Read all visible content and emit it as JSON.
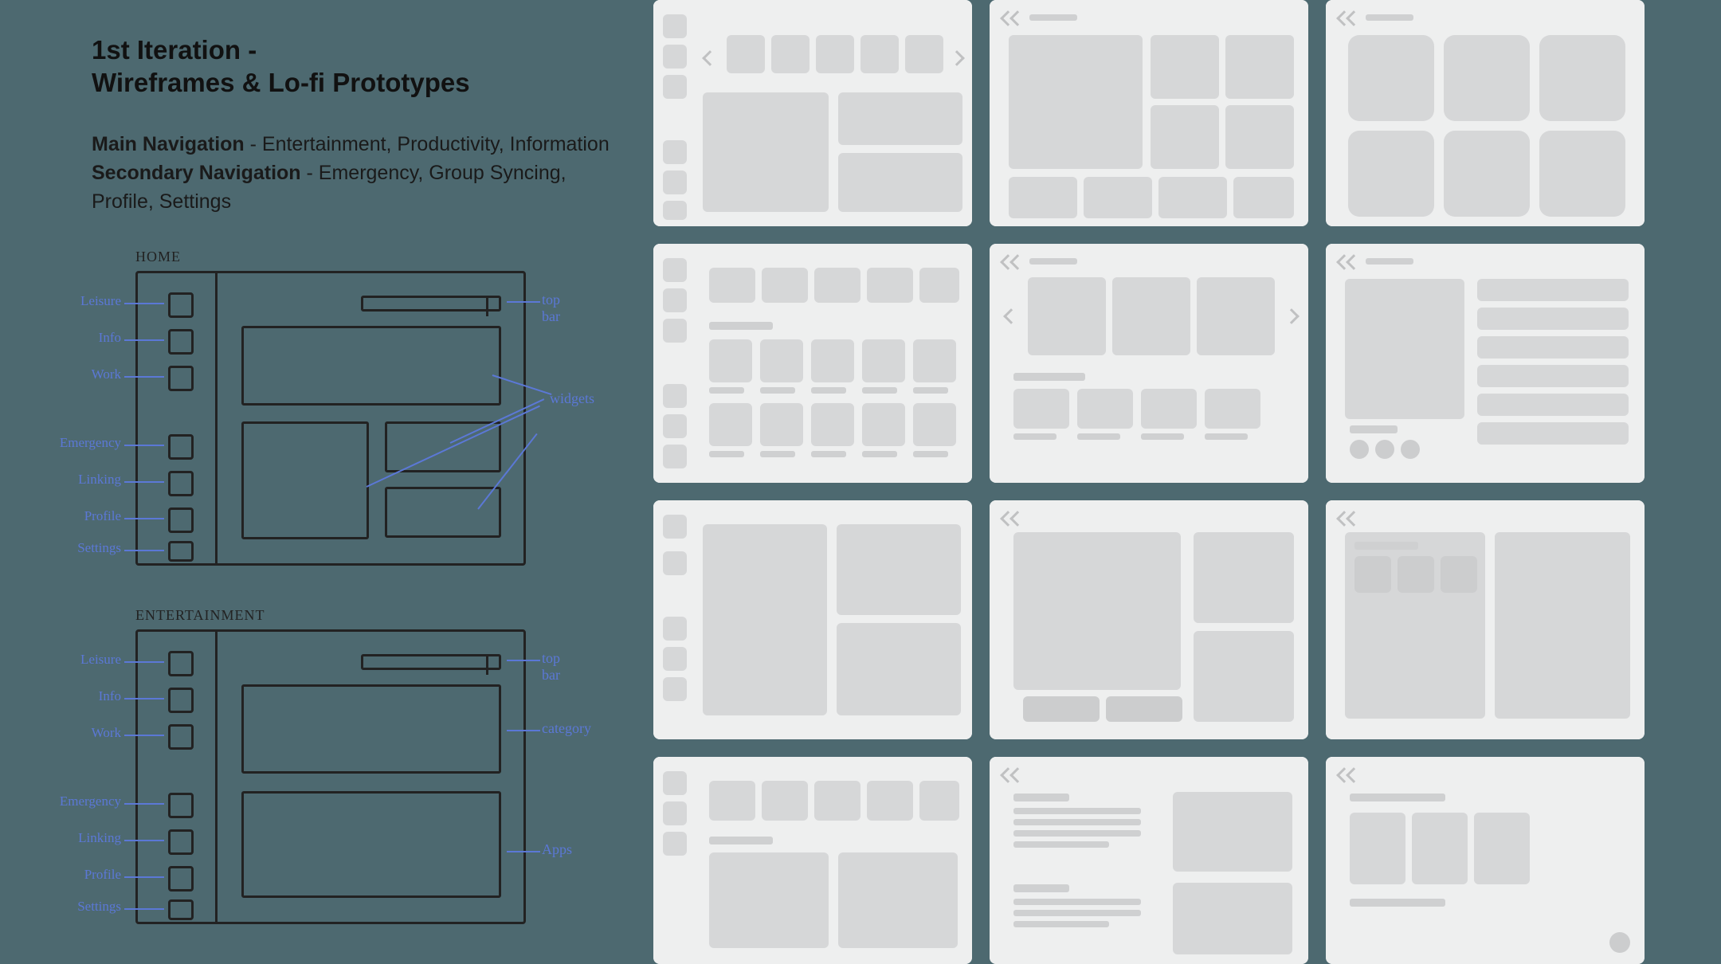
{
  "title_line1": "1st Iteration -",
  "title_line2": "Wireframes & Lo-fi Prototypes",
  "main_nav": {
    "label": "Main Navigation",
    "rest": " - Entertainment, Productivity, Information"
  },
  "secondary_nav": {
    "label": "Secondary Navigation",
    "rest": " - Emergency, Group Syncing, Profile, Settings"
  },
  "sketch_home": {
    "label": "HOME",
    "sidebar": [
      "Leisure",
      "Info",
      "Work",
      "Emergency",
      "Linking",
      "Profile",
      "Settings"
    ],
    "anno_topbar": "top bar",
    "anno_widgets": "widgets"
  },
  "sketch_ent": {
    "label": "ENTERTAINMENT",
    "sidebar": [
      "Leisure",
      "Info",
      "Work",
      "Emergency",
      "Linking",
      "Profile",
      "Settings"
    ],
    "anno_topbar": "top bar",
    "anno_category": "category",
    "anno_apps": "Apps"
  },
  "colors": {
    "bg": "#4d6970",
    "card": "#eeefef",
    "block": "#d6d7d8",
    "anno": "#5b78d6"
  }
}
